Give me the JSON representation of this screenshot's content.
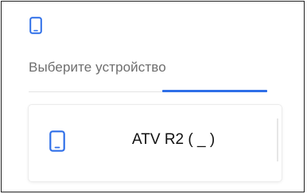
{
  "header": {
    "icon": "tablet-icon"
  },
  "title": "Выберите устройство",
  "colors": {
    "accent": "#2f6fe8",
    "divider": "#e4e4e4",
    "title_text": "#6e6e6e"
  },
  "devices": [
    {
      "icon": "tablet-icon",
      "label": "ATV R2 ( _ )"
    }
  ]
}
